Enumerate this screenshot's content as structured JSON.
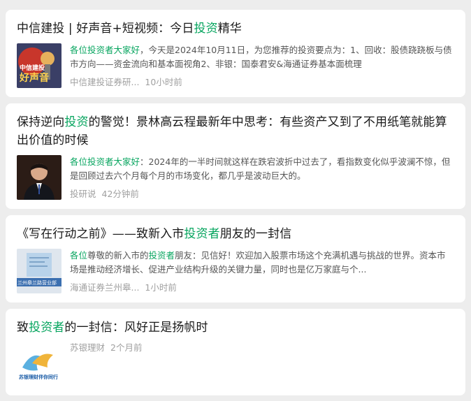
{
  "results": [
    {
      "title_parts": [
        "中信建投 | 好声音+短视频：今日",
        "投资",
        "精华"
      ],
      "snippet_lead": "各位投资者大家好",
      "snippet_rest": "，今天是2024年10月11日，为您推荐的投资要点为：1、回收：股债跷跷板与债市方向——资金流向和基本面视角2、非银：国泰君安&海通证券基本面梳理",
      "thumb_text": [
        "中信建投",
        "好声音"
      ],
      "source": "中信建投证券研...",
      "time": "10小时前"
    },
    {
      "title_parts": [
        "保持逆向",
        "投资",
        "的警觉！景林高云程最新年中思考：有些资产又到了不用纸笔就能算出价值的时候"
      ],
      "snippet_lead": "各位投资者大家好",
      "snippet_rest": "：2024年的一半时间就这样在跌宕波折中过去了，看指数变化似乎波澜不惊，但是回顾过去六个月每个月的市场变化，都几乎是波动巨大的。",
      "source": "投研说",
      "time": "42分钟前"
    },
    {
      "title_parts": [
        "《写在行动之前》——致新入市",
        "投资者",
        "朋友的一封信"
      ],
      "snippet_parts": [
        "各位",
        "尊敬的新入市的",
        "投资者",
        "朋友：见信好！欢迎加入股票市场这个充满机遇与挑战的世界。资本市场是推动经济增长、促进产业结构升级的关键力量，同时也是亿万家庭与个..."
      ],
      "thumb_text": "兰州皋兰路营业部",
      "source": "海通证券兰州皋...",
      "time": "1小时前"
    },
    {
      "title_parts": [
        "致",
        "投资者",
        "的一封信：风好正是扬帆时"
      ],
      "thumb_text": "苏银理财伴你同行",
      "source": "苏银理财",
      "time": "2个月前"
    }
  ],
  "colors": {
    "highlight": "#07a55f",
    "background": "#ededed",
    "card": "#ffffff"
  }
}
